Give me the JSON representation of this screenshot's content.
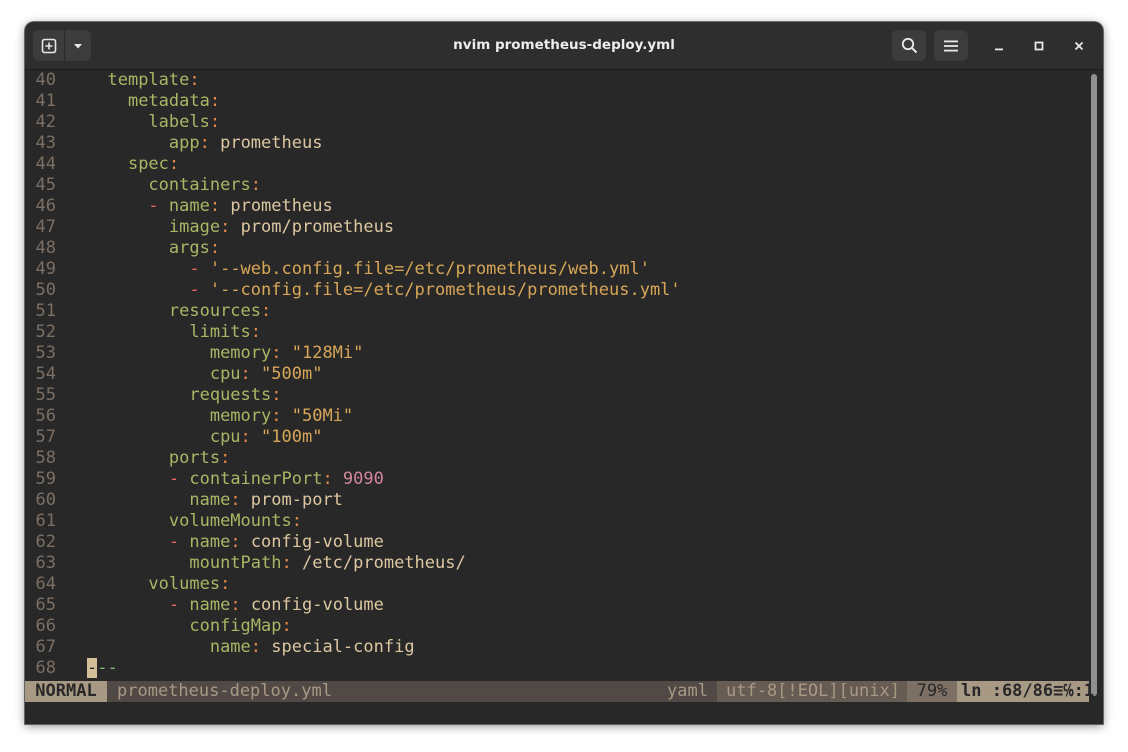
{
  "window": {
    "title": "nvim prometheus-deploy.yml",
    "new_tab_icon": "new-tab-icon",
    "menu_arrow_icon": "chevron-down-icon",
    "search_icon": "search-icon",
    "menu_icon": "hamburger-icon"
  },
  "editor": {
    "lines": [
      {
        "num": "40",
        "indent": "  ",
        "dash": "",
        "key": "template",
        "colon": ":",
        "val": "",
        "val_type": ""
      },
      {
        "num": "41",
        "indent": "    ",
        "dash": "",
        "key": "metadata",
        "colon": ":",
        "val": "",
        "val_type": ""
      },
      {
        "num": "42",
        "indent": "      ",
        "dash": "",
        "key": "labels",
        "colon": ":",
        "val": "",
        "val_type": ""
      },
      {
        "num": "43",
        "indent": "        ",
        "dash": "",
        "key": "app",
        "colon": ":",
        "val": " prometheus",
        "val_type": "plain"
      },
      {
        "num": "44",
        "indent": "    ",
        "dash": "",
        "key": "spec",
        "colon": ":",
        "val": "",
        "val_type": ""
      },
      {
        "num": "45",
        "indent": "      ",
        "dash": "",
        "key": "containers",
        "colon": ":",
        "val": "",
        "val_type": ""
      },
      {
        "num": "46",
        "indent": "      ",
        "dash": "- ",
        "key": "name",
        "colon": ":",
        "val": " prometheus",
        "val_type": "plain"
      },
      {
        "num": "47",
        "indent": "        ",
        "dash": "",
        "key": "image",
        "colon": ":",
        "val": " prom/prometheus",
        "val_type": "plain"
      },
      {
        "num": "48",
        "indent": "        ",
        "dash": "",
        "key": "args",
        "colon": ":",
        "val": "",
        "val_type": ""
      },
      {
        "num": "49",
        "indent": "          ",
        "dash": "- ",
        "key": "",
        "colon": "",
        "val": "'--web.config.file=/etc/prometheus/web.yml'",
        "val_type": "string"
      },
      {
        "num": "50",
        "indent": "          ",
        "dash": "- ",
        "key": "",
        "colon": "",
        "val": "'--config.file=/etc/prometheus/prometheus.yml'",
        "val_type": "string"
      },
      {
        "num": "51",
        "indent": "        ",
        "dash": "",
        "key": "resources",
        "colon": ":",
        "val": "",
        "val_type": ""
      },
      {
        "num": "52",
        "indent": "          ",
        "dash": "",
        "key": "limits",
        "colon": ":",
        "val": "",
        "val_type": ""
      },
      {
        "num": "53",
        "indent": "            ",
        "dash": "",
        "key": "memory",
        "colon": ":",
        "val": " \"128Mi\"",
        "val_type": "string"
      },
      {
        "num": "54",
        "indent": "            ",
        "dash": "",
        "key": "cpu",
        "colon": ":",
        "val": " \"500m\"",
        "val_type": "string"
      },
      {
        "num": "55",
        "indent": "          ",
        "dash": "",
        "key": "requests",
        "colon": ":",
        "val": "",
        "val_type": ""
      },
      {
        "num": "56",
        "indent": "            ",
        "dash": "",
        "key": "memory",
        "colon": ":",
        "val": " \"50Mi\"",
        "val_type": "string"
      },
      {
        "num": "57",
        "indent": "            ",
        "dash": "",
        "key": "cpu",
        "colon": ":",
        "val": " \"100m\"",
        "val_type": "string"
      },
      {
        "num": "58",
        "indent": "        ",
        "dash": "",
        "key": "ports",
        "colon": ":",
        "val": "",
        "val_type": ""
      },
      {
        "num": "59",
        "indent": "        ",
        "dash": "- ",
        "key": "containerPort",
        "colon": ":",
        "val": " 9090",
        "val_type": "number"
      },
      {
        "num": "60",
        "indent": "          ",
        "dash": "",
        "key": "name",
        "colon": ":",
        "val": " prom-port",
        "val_type": "plain"
      },
      {
        "num": "61",
        "indent": "        ",
        "dash": "",
        "key": "volumeMounts",
        "colon": ":",
        "val": "",
        "val_type": ""
      },
      {
        "num": "62",
        "indent": "        ",
        "dash": "- ",
        "key": "name",
        "colon": ":",
        "val": " config-volume",
        "val_type": "plain"
      },
      {
        "num": "63",
        "indent": "          ",
        "dash": "",
        "key": "mountPath",
        "colon": ":",
        "val": " /etc/prometheus/",
        "val_type": "plain"
      },
      {
        "num": "64",
        "indent": "      ",
        "dash": "",
        "key": "volumes",
        "colon": ":",
        "val": "",
        "val_type": ""
      },
      {
        "num": "65",
        "indent": "        ",
        "dash": "- ",
        "key": "name",
        "colon": ":",
        "val": " config-volume",
        "val_type": "plain"
      },
      {
        "num": "66",
        "indent": "          ",
        "dash": "",
        "key": "configMap",
        "colon": ":",
        "val": "",
        "val_type": ""
      },
      {
        "num": "67",
        "indent": "            ",
        "dash": "",
        "key": "name",
        "colon": ":",
        "val": " special-config",
        "val_type": "plain"
      }
    ],
    "last_line": {
      "num": "68",
      "cursor_char": "-",
      "rest": "--"
    }
  },
  "statusline": {
    "mode": "NORMAL",
    "filename": "prometheus-deploy.yml",
    "filetype": "yaml",
    "encoding": "utf-8[!EOL][unix]",
    "percent": "79%",
    "position": "ln :68/86≡℅:1"
  },
  "colors": {
    "background": "#282828",
    "key": "#a9b665",
    "colon": "#e78a4e",
    "dash": "#ea6962",
    "string": "#d8a657",
    "number": "#d3869b",
    "line_number": "#7c6f64",
    "document_marker": "#89b482"
  }
}
